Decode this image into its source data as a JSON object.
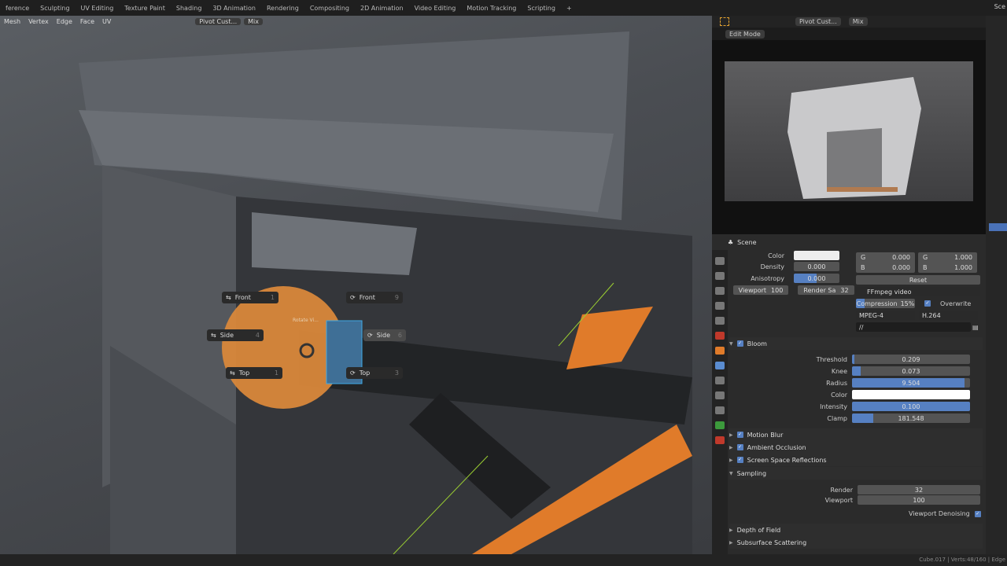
{
  "workspaces": [
    "ference",
    "Sculpting",
    "UV Editing",
    "Texture Paint",
    "Shading",
    "3D Animation",
    "Rendering",
    "Compositing",
    "2D Animation",
    "Video Editing",
    "Motion Tracking",
    "Scripting",
    "+"
  ],
  "scene_label": "Sce",
  "viewport": {
    "menus": [
      "Mesh",
      "Vertex",
      "Edge",
      "Face",
      "UV"
    ],
    "pivot": "Pivot Cust...",
    "snap": "Mix"
  },
  "pie_menu": {
    "title": "Rotate Vi...",
    "items": [
      {
        "label": "Front",
        "key": "1"
      },
      {
        "label": "Side",
        "key": "4"
      },
      {
        "label": "Top",
        "key": "1"
      },
      {
        "label": "Front",
        "key": "9"
      },
      {
        "label": "Side",
        "key": "6"
      },
      {
        "label": "Top",
        "key": "3"
      }
    ]
  },
  "preview": {
    "mode": "Edit Mode",
    "pivot": "Pivot Cust...",
    "snap": "Mix"
  },
  "properties": {
    "context": "Scene",
    "volumetric": {
      "color_label": "Color",
      "density_label": "Density",
      "density": "0.000",
      "aniso_label": "Anisotropy",
      "aniso": "0.000",
      "viewport": "Viewport",
      "viewport_val": "100",
      "render": "Render Sa",
      "render_val": "32"
    },
    "colors": {
      "g1": "G",
      "g1v": "0.000",
      "b1": "B",
      "b1v": "0.000",
      "g2": "G",
      "g2v": "1.000",
      "b2": "B",
      "b2v": "1.000",
      "reset": "Reset"
    },
    "output": {
      "format": "FFmpeg video",
      "compression": "Compression",
      "compression_val": "15%",
      "overwrite": "Overwrite",
      "container": "MPEG-4",
      "codec": "H.264",
      "path": "//"
    },
    "bloom": {
      "title": "Bloom",
      "fields": [
        {
          "label": "Threshold",
          "value": "0.209",
          "fill": 0.02
        },
        {
          "label": "Knee",
          "value": "0.073",
          "fill": 0.07
        },
        {
          "label": "Radius",
          "value": "9.504",
          "fill": 0.95
        },
        {
          "label": "Color",
          "value": "",
          "fill": 0
        },
        {
          "label": "Intensity",
          "value": "0.100",
          "fill": 1.0
        },
        {
          "label": "Clamp",
          "value": "181.548",
          "fill": 0.18
        }
      ]
    },
    "sections": [
      "Motion Blur",
      "Ambient Occlusion",
      "Screen Space Reflections"
    ],
    "sampling": {
      "title": "Sampling",
      "render_label": "Render",
      "render": "32",
      "viewport_label": "Viewport",
      "viewport": "100",
      "denoise": "Viewport Denoising"
    },
    "collapsed": [
      "Depth of Field",
      "Subsurface Scattering"
    ]
  },
  "status": "Cube.017 | Verts:48/160 | Edge"
}
